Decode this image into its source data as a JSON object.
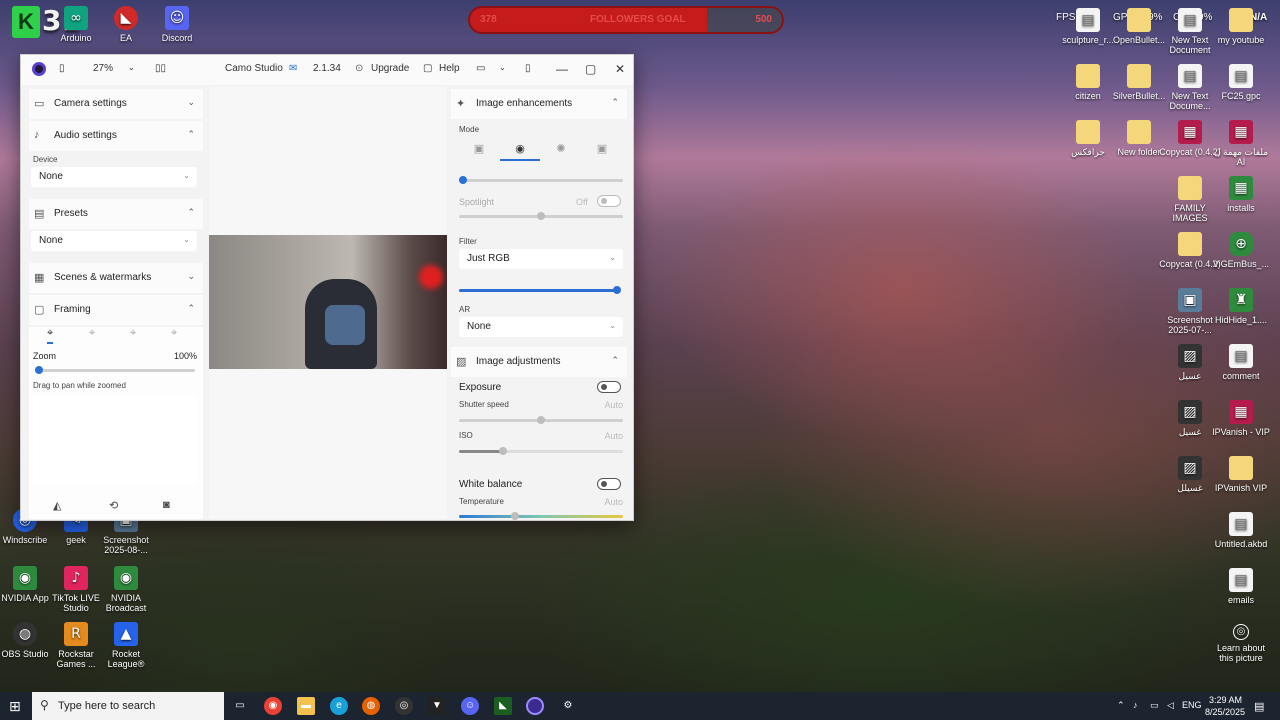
{
  "overlays": {
    "counter_letter": "K",
    "counter_value": "31",
    "goal_left": "378",
    "goal_label": "FOLLOWERS GOAL",
    "goal_right": "500",
    "goal_progress": 0.76,
    "fps": "FPS",
    "gpu": "GPU",
    "gpu_val": "9%",
    "cpu": "CPU",
    "cpu_val": "9%",
    "na": "N/A"
  },
  "desktop_left": [
    {
      "label": "Arduino",
      "icon": "arduino-icon"
    },
    {
      "label": "EA",
      "icon": "ea-icon"
    },
    {
      "label": "Discord",
      "icon": "discord-icon"
    },
    {
      "label": "Windscribe",
      "icon": "windscribe-icon"
    },
    {
      "label": "geek",
      "icon": "geek-icon"
    },
    {
      "label": "Screenshot 2025-08-...",
      "icon": "screenshot-icon"
    },
    {
      "label": "NVIDIA App",
      "icon": "nvidia-icon"
    },
    {
      "label": "TikTok LIVE Studio",
      "icon": "tiktok-icon"
    },
    {
      "label": "NVIDIA Broadcast",
      "icon": "nvidia-broadcast-icon"
    },
    {
      "label": "OBS Studio",
      "icon": "obs-icon"
    },
    {
      "label": "Rockstar Games ...",
      "icon": "rockstar-icon"
    },
    {
      "label": "Rocket League®",
      "icon": "rocket-league-icon"
    }
  ],
  "desktop_right": [
    {
      "label": "sculpture_r...",
      "icon": "file-icon"
    },
    {
      "label": "OpenBullet...",
      "icon": "folder-icon"
    },
    {
      "label": "New Text Document",
      "icon": "file-icon"
    },
    {
      "label": "my youtube",
      "icon": "folder-icon"
    },
    {
      "label": "citizen",
      "icon": "folder-icon"
    },
    {
      "label": "SilverBullet...",
      "icon": "folder-icon"
    },
    {
      "label": "New Text Docume...",
      "icon": "file-icon"
    },
    {
      "label": "FC25.gpc",
      "icon": "file-icon"
    },
    {
      "label": "جرافكس",
      "icon": "folder-icon"
    },
    {
      "label": "New folder",
      "icon": "folder-icon"
    },
    {
      "label": "Copycat (0.4.2)",
      "icon": "winrar-icon"
    },
    {
      "label": "ملفات مهمة ل AI",
      "icon": "winrar-icon"
    },
    {
      "label": "FAMILY IMAGES",
      "icon": "folder-icon"
    },
    {
      "label": "installs",
      "icon": "installs-icon"
    },
    {
      "label": "Copycat (0.4.2)",
      "icon": "folder-icon"
    },
    {
      "label": "ViGEmBus_...",
      "icon": "vigem-icon"
    },
    {
      "label": "Screenshot 2025-07-...",
      "icon": "screenshot-icon"
    },
    {
      "label": "HidHide_1....",
      "icon": "hidhide-icon"
    },
    {
      "label": "عسيل",
      "icon": "image-icon"
    },
    {
      "label": "comment",
      "icon": "file-icon"
    },
    {
      "label": "غسيل",
      "icon": "image-icon"
    },
    {
      "label": "IPVanish - VIP",
      "icon": "winrar-icon"
    },
    {
      "label": "غسيلل",
      "icon": "image-icon"
    },
    {
      "label": "IPVanish VIP",
      "icon": "folder-icon"
    },
    {
      "label": "Untitled.akbd",
      "icon": "file-icon"
    },
    {
      "label": "emails",
      "icon": "file-icon"
    },
    {
      "label": "Learn about this picture",
      "icon": "learn-icon"
    }
  ],
  "camo": {
    "zoom": "27%",
    "app_name": "Camo Studio",
    "version": "2.1.34",
    "upgrade": "Upgrade",
    "help": "Help",
    "left": {
      "camera_settings": "Camera settings",
      "audio_settings": "Audio settings",
      "device_label": "Device",
      "device_value": "None",
      "presets": "Presets",
      "preset_value": "None",
      "scenes": "Scenes & watermarks",
      "framing": "Framing",
      "zoom_label": "Zoom",
      "zoom_value": "100%",
      "zoom_hint": "Drag to pan while zoomed"
    },
    "right": {
      "image_enhancements": "Image enhancements",
      "mode_label": "Mode",
      "spotlight": "Spotlight",
      "spotlight_state": "Off",
      "filter_label": "Filter",
      "filter_value": "Just RGB",
      "ar_label": "AR",
      "ar_value": "None",
      "image_adjustments": "Image adjustments",
      "exposure": "Exposure",
      "shutter_speed": "Shutter speed",
      "shutter_value": "Auto",
      "iso": "ISO",
      "iso_value": "Auto",
      "white_balance": "White balance",
      "temperature": "Temperature",
      "temperature_value": "Auto"
    }
  },
  "taskbar": {
    "search_placeholder": "Type here to search",
    "language": "ENG",
    "time": "3:29 AM",
    "date": "8/25/2025"
  }
}
